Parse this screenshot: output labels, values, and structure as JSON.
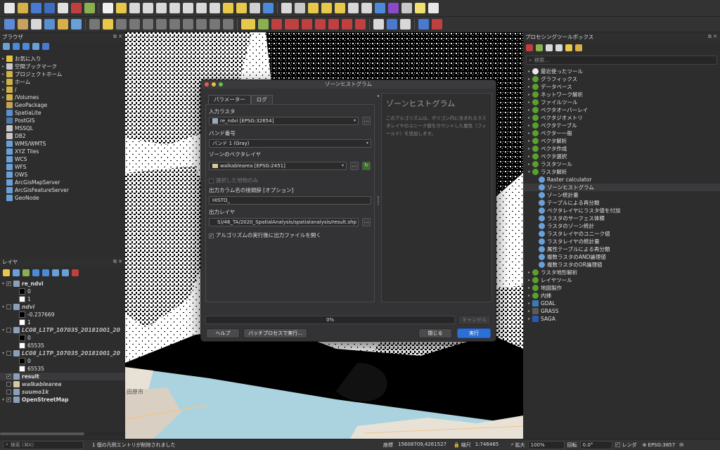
{
  "browser_panel": {
    "title": "ブラウザ",
    "items": [
      {
        "label": "お気に入り",
        "icon": "star-icon",
        "color": "#e6c23a"
      },
      {
        "label": "空間ブックマーク",
        "icon": "bookmark-icon",
        "color": "#c8c8c8"
      },
      {
        "label": "プロジェクトホーム",
        "icon": "folder-icon",
        "color": "#d0b24a"
      },
      {
        "label": "ホーム",
        "icon": "folder-icon",
        "color": "#d0b24a"
      },
      {
        "label": "/",
        "icon": "folder-icon",
        "color": "#d0b24a"
      },
      {
        "label": "/Volumes",
        "icon": "folder-icon",
        "color": "#d0b24a"
      },
      {
        "label": "GeoPackage",
        "icon": "geopackage-icon",
        "color": "#c8a060"
      },
      {
        "label": "SpatiaLite",
        "icon": "spatialite-icon",
        "color": "#5a8fd0"
      },
      {
        "label": "PostGIS",
        "icon": "postgis-icon",
        "color": "#4a78b0"
      },
      {
        "label": "MSSQL",
        "icon": "mssql-icon",
        "color": "#c8c8c8"
      },
      {
        "label": "DB2",
        "icon": "db2-icon",
        "color": "#c8c8c8"
      },
      {
        "label": "WMS/WMTS",
        "icon": "globe-icon",
        "color": "#6aa0d8"
      },
      {
        "label": "XYZ Tiles",
        "icon": "tiles-icon",
        "color": "#6aa0d8"
      },
      {
        "label": "WCS",
        "icon": "globe-icon",
        "color": "#6aa0d8"
      },
      {
        "label": "WFS",
        "icon": "globe-icon",
        "color": "#6aa0d8"
      },
      {
        "label": "OWS",
        "icon": "globe-icon",
        "color": "#6aa0d8"
      },
      {
        "label": "ArcGisMapServer",
        "icon": "globe-icon",
        "color": "#6aa0d8"
      },
      {
        "label": "ArcGisFeatureServer",
        "icon": "globe-icon",
        "color": "#6aa0d8"
      },
      {
        "label": "GeoNode",
        "icon": "geonode-icon",
        "color": "#6aa0d8"
      }
    ]
  },
  "layers_panel": {
    "title": "レイヤ",
    "items": [
      {
        "label": "re_ndvi",
        "bold": true,
        "checked": true,
        "level": 0,
        "swatch": ""
      },
      {
        "label": "0",
        "bold": false,
        "level": 1,
        "swatch": "#000000"
      },
      {
        "label": "1",
        "bold": false,
        "level": 1,
        "swatch": "#ffffff"
      },
      {
        "label": "ndvi",
        "bold": true,
        "italic": true,
        "checked": false,
        "level": 0,
        "swatch": ""
      },
      {
        "label": "-0.237669",
        "bold": false,
        "level": 1,
        "swatch": "#000000"
      },
      {
        "label": "1",
        "bold": false,
        "level": 1,
        "swatch": "#ffffff"
      },
      {
        "label": "LC08_L1TP_107035_20181001_20",
        "bold": true,
        "italic": true,
        "checked": false,
        "level": 0,
        "swatch": ""
      },
      {
        "label": "0",
        "bold": false,
        "level": 1,
        "swatch": "#000000"
      },
      {
        "label": "65535",
        "bold": false,
        "level": 1,
        "swatch": "#ffffff"
      },
      {
        "label": "LC08_L1TP_107035_20181001_20",
        "bold": true,
        "italic": true,
        "checked": false,
        "level": 0,
        "swatch": ""
      },
      {
        "label": "0",
        "bold": false,
        "level": 1,
        "swatch": "#000000"
      },
      {
        "label": "65535",
        "bold": false,
        "level": 1,
        "swatch": "#ffffff"
      },
      {
        "label": "result",
        "bold": true,
        "checked": true,
        "level": 0,
        "swatch": "",
        "selected": true
      },
      {
        "label": "walkablearea",
        "bold": true,
        "italic": true,
        "checked": false,
        "level": 0,
        "swatch": "#d8c8a0"
      },
      {
        "label": "suumo1k",
        "bold": true,
        "italic": true,
        "checked": false,
        "level": 0,
        "swatch": ""
      },
      {
        "label": "OpenStreetMap",
        "bold": true,
        "checked": true,
        "level": 0,
        "swatch": ""
      }
    ]
  },
  "toolbox_panel": {
    "title": "プロセシングツールボックス",
    "search_placeholder": "検索...",
    "items": [
      {
        "label": "最近使ったツール",
        "level": 0,
        "type": "clock"
      },
      {
        "label": "グラフィックス",
        "level": 0,
        "type": "q"
      },
      {
        "label": "データベース",
        "level": 0,
        "type": "q"
      },
      {
        "label": "ネットワーク解析",
        "level": 0,
        "type": "q"
      },
      {
        "label": "ファイルツール",
        "level": 0,
        "type": "q"
      },
      {
        "label": "ベクタオーバーレイ",
        "level": 0,
        "type": "q"
      },
      {
        "label": "ベクタジオメトリ",
        "level": 0,
        "type": "q"
      },
      {
        "label": "ベクタテーブル",
        "level": 0,
        "type": "q"
      },
      {
        "label": "ベクター一般",
        "level": 0,
        "type": "q"
      },
      {
        "label": "ベクタ解析",
        "level": 0,
        "type": "q"
      },
      {
        "label": "ベクタ作成",
        "level": 0,
        "type": "q"
      },
      {
        "label": "ベクタ選択",
        "level": 0,
        "type": "q"
      },
      {
        "label": "ラスタツール",
        "level": 0,
        "type": "q"
      },
      {
        "label": "ラスタ解析",
        "level": 0,
        "type": "q",
        "expanded": true
      },
      {
        "label": "Raster calculator",
        "level": 1,
        "type": "gear"
      },
      {
        "label": "ゾーンヒストグラム",
        "level": 1,
        "type": "gear",
        "selected": true
      },
      {
        "label": "ゾーン統計量",
        "level": 1,
        "type": "gear"
      },
      {
        "label": "テーブルによる再分類",
        "level": 1,
        "type": "gear"
      },
      {
        "label": "ベクタレイヤにラスタ値を付加",
        "level": 1,
        "type": "gear"
      },
      {
        "label": "ラスタのサーフェス体積",
        "level": 1,
        "type": "gear"
      },
      {
        "label": "ラスタのゾーン統計",
        "level": 1,
        "type": "gear"
      },
      {
        "label": "ラスタレイヤのユニーク値",
        "level": 1,
        "type": "gear"
      },
      {
        "label": "ラスタレイヤの統計量",
        "level": 1,
        "type": "gear"
      },
      {
        "label": "属性テーブルによる再分類",
        "level": 1,
        "type": "gear"
      },
      {
        "label": "複数ラスタのAND論理値",
        "level": 1,
        "type": "gear"
      },
      {
        "label": "複数ラスタのOR論理値",
        "level": 1,
        "type": "gear"
      },
      {
        "label": "ラスタ地形解析",
        "level": 0,
        "type": "q"
      },
      {
        "label": "レイヤツール",
        "level": 0,
        "type": "q"
      },
      {
        "label": "地図製作",
        "level": 0,
        "type": "q"
      },
      {
        "label": "内挿",
        "level": 0,
        "type": "q"
      },
      {
        "label": "GDAL",
        "level": 0,
        "type": "gdal"
      },
      {
        "label": "GRASS",
        "level": 0,
        "type": "grass"
      },
      {
        "label": "SAGA",
        "level": 0,
        "type": "saga"
      }
    ]
  },
  "dialog": {
    "title": "ゾーンヒストグラム",
    "tab_params": "パラメーター",
    "tab_log": "ログ",
    "input_raster_label": "入力ラスタ",
    "input_raster_value": "re_ndvi [EPSG:32654]",
    "band_label": "バンド番号",
    "band_value": "バンド 1 (Gray)",
    "zones_label": "ゾーンのベクタレイヤ",
    "zones_value": "walkablearea [EPSG:2451]",
    "selected_only_label": "選択した地物のみ",
    "prefix_label": "出力カラム名の接頭辞 [オプション]",
    "prefix_value": "HISTO_",
    "output_label": "出力レイヤ",
    "output_value": "                            S)/46_TA/2020_SpatialAnalysis/spatialanalysis/result.shp",
    "open_output_label": "アルゴリズムの実行後に出力ファイルを開く",
    "help_title": "ゾーンヒストグラム",
    "help_text": "このアルゴリズムは、ポリゴン内に含まれるラスタレイヤのユニーク値をカウントした属性（フィールド）を追加します。",
    "progress_text": "0%",
    "cancel_label": "キャンセル",
    "help_button": "ヘルプ",
    "batch_button": "バッチプロセスで実行...",
    "close_button": "閉じる",
    "run_button": "実行"
  },
  "map_labels": {
    "city_label": "田原市"
  },
  "statusbar": {
    "search_placeholder": "検索 (⌘K)",
    "message": "1 個の凡例エントリが削除されました",
    "coord_label": "座標",
    "coord_value": "15608709,4261527",
    "scale_label": "縮尺",
    "scale_value": "1:746465",
    "magnifier_label": "拡大",
    "magnifier_value": "100%",
    "rotation_label": "回転",
    "rotation_value": "0.0°",
    "render_label": "レンダ",
    "crs_value": "EPSG:3857"
  },
  "colors": {
    "accent": "#2c6fd6",
    "qgis_green": "#5aa02c",
    "selection": "#3a3a3c"
  }
}
